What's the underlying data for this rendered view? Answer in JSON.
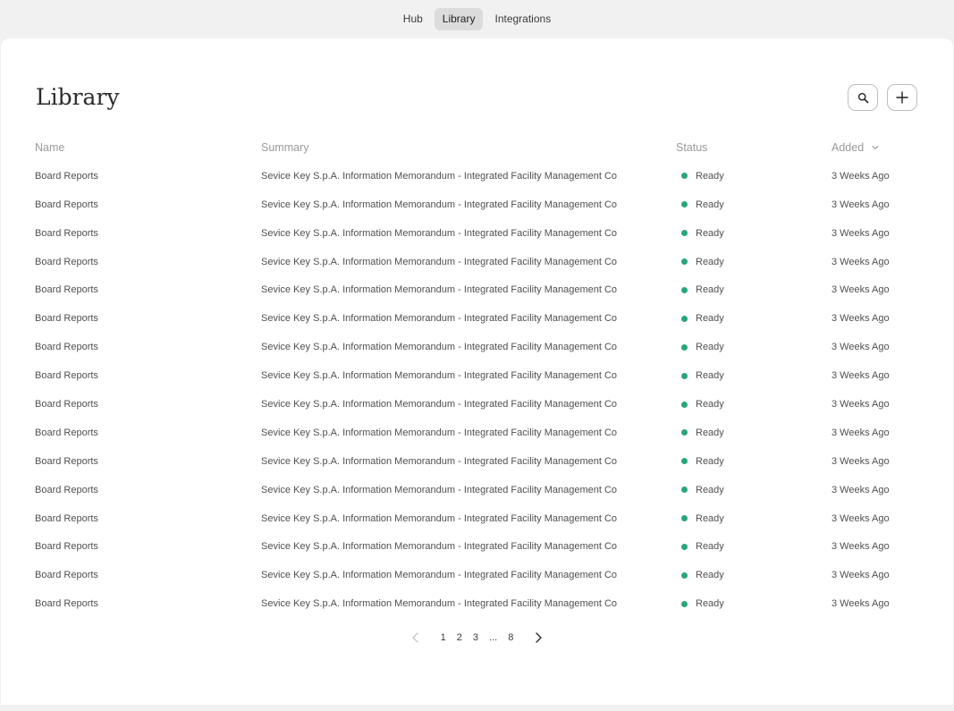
{
  "nav": {
    "tabs": [
      {
        "label": "Hub"
      },
      {
        "label": "Library"
      },
      {
        "label": "Integrations"
      }
    ],
    "active": "Library"
  },
  "page": {
    "title": "Library"
  },
  "table": {
    "columns": {
      "name": "Name",
      "summary": "Summary",
      "status": "Status",
      "added": "Added"
    },
    "rows": [
      {
        "name": "Board Reports",
        "summary": "Sevice Key S.p.A. Information Memorandum - Integrated Facility Management Co",
        "status": "Ready",
        "added": "3 Weeks Ago"
      },
      {
        "name": "Board Reports",
        "summary": "Sevice Key S.p.A. Information Memorandum - Integrated Facility Management Co",
        "status": "Ready",
        "added": "3 Weeks Ago"
      },
      {
        "name": "Board Reports",
        "summary": "Sevice Key S.p.A. Information Memorandum - Integrated Facility Management Co",
        "status": "Ready",
        "added": "3 Weeks Ago"
      },
      {
        "name": "Board Reports",
        "summary": "Sevice Key S.p.A. Information Memorandum - Integrated Facility Management Co",
        "status": "Ready",
        "added": "3 Weeks Ago"
      },
      {
        "name": "Board Reports",
        "summary": "Sevice Key S.p.A. Information Memorandum - Integrated Facility Management Co",
        "status": "Ready",
        "added": "3 Weeks Ago"
      },
      {
        "name": "Board Reports",
        "summary": "Sevice Key S.p.A. Information Memorandum - Integrated Facility Management Co",
        "status": "Ready",
        "added": "3 Weeks Ago"
      },
      {
        "name": "Board Reports",
        "summary": "Sevice Key S.p.A. Information Memorandum - Integrated Facility Management Co",
        "status": "Ready",
        "added": "3 Weeks Ago"
      },
      {
        "name": "Board Reports",
        "summary": "Sevice Key S.p.A. Information Memorandum - Integrated Facility Management Co",
        "status": "Ready",
        "added": "3 Weeks Ago"
      },
      {
        "name": "Board Reports",
        "summary": "Sevice Key S.p.A. Information Memorandum - Integrated Facility Management Co",
        "status": "Ready",
        "added": "3 Weeks Ago"
      },
      {
        "name": "Board Reports",
        "summary": "Sevice Key S.p.A. Information Memorandum - Integrated Facility Management Co",
        "status": "Ready",
        "added": "3 Weeks Ago"
      },
      {
        "name": "Board Reports",
        "summary": "Sevice Key S.p.A. Information Memorandum - Integrated Facility Management Co",
        "status": "Ready",
        "added": "3 Weeks Ago"
      },
      {
        "name": "Board Reports",
        "summary": "Sevice Key S.p.A. Information Memorandum - Integrated Facility Management Co",
        "status": "Ready",
        "added": "3 Weeks Ago"
      },
      {
        "name": "Board Reports",
        "summary": "Sevice Key S.p.A. Information Memorandum - Integrated Facility Management Co",
        "status": "Ready",
        "added": "3 Weeks Ago"
      },
      {
        "name": "Board Reports",
        "summary": "Sevice Key S.p.A. Information Memorandum - Integrated Facility Management Co",
        "status": "Ready",
        "added": "3 Weeks Ago"
      },
      {
        "name": "Board Reports",
        "summary": "Sevice Key S.p.A. Information Memorandum - Integrated Facility Management Co",
        "status": "Ready",
        "added": "3 Weeks Ago"
      },
      {
        "name": "Board Reports",
        "summary": "Sevice Key S.p.A. Information Memorandum - Integrated Facility Management Co",
        "status": "Ready",
        "added": "3 Weeks Ago"
      }
    ]
  },
  "pagination": {
    "pages": [
      "1",
      "2",
      "3",
      "...",
      "8"
    ]
  },
  "icons": {
    "search": "search-icon",
    "add": "plus-icon",
    "sort": "chevron-down-icon",
    "prev": "chevron-left-icon",
    "next": "chevron-right-icon"
  },
  "colors": {
    "status_ready": "#2aa57a",
    "active_tab_bg": "#dcdcdc"
  }
}
